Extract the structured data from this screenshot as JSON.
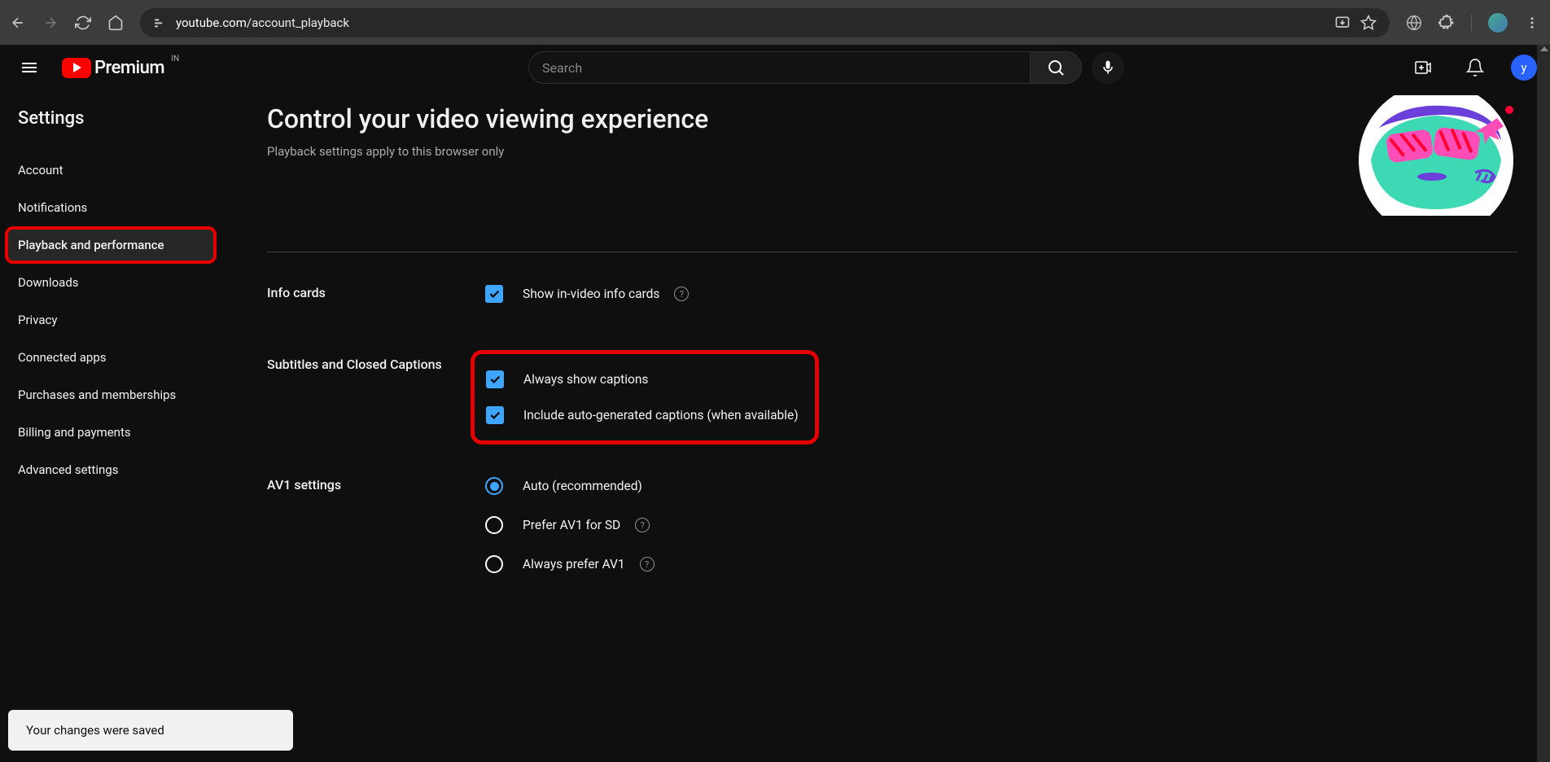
{
  "browser": {
    "url_domain": "youtube.com",
    "url_path": "/account_playback"
  },
  "header": {
    "logo_text": "Premium",
    "country": "IN",
    "search_placeholder": "Search",
    "avatar_letter": "y"
  },
  "sidebar": {
    "title": "Settings",
    "items": [
      {
        "label": "Account"
      },
      {
        "label": "Notifications"
      },
      {
        "label": "Playback and performance",
        "active": true
      },
      {
        "label": "Downloads"
      },
      {
        "label": "Privacy"
      },
      {
        "label": "Connected apps"
      },
      {
        "label": "Purchases and memberships"
      },
      {
        "label": "Billing and payments"
      },
      {
        "label": "Advanced settings"
      }
    ]
  },
  "content": {
    "title": "Control your video viewing experience",
    "subtitle": "Playback settings apply to this browser only",
    "sections": {
      "info_cards": {
        "label": "Info cards",
        "option1": "Show in-video info cards"
      },
      "subtitles": {
        "label": "Subtitles and Closed Captions",
        "option1": "Always show captions",
        "option2": "Include auto-generated captions (when available)"
      },
      "av1": {
        "label": "AV1 settings",
        "option1": "Auto (recommended)",
        "option2": "Prefer AV1 for SD",
        "option3": "Always prefer AV1"
      }
    }
  },
  "toast": {
    "message": "Your changes were saved"
  }
}
